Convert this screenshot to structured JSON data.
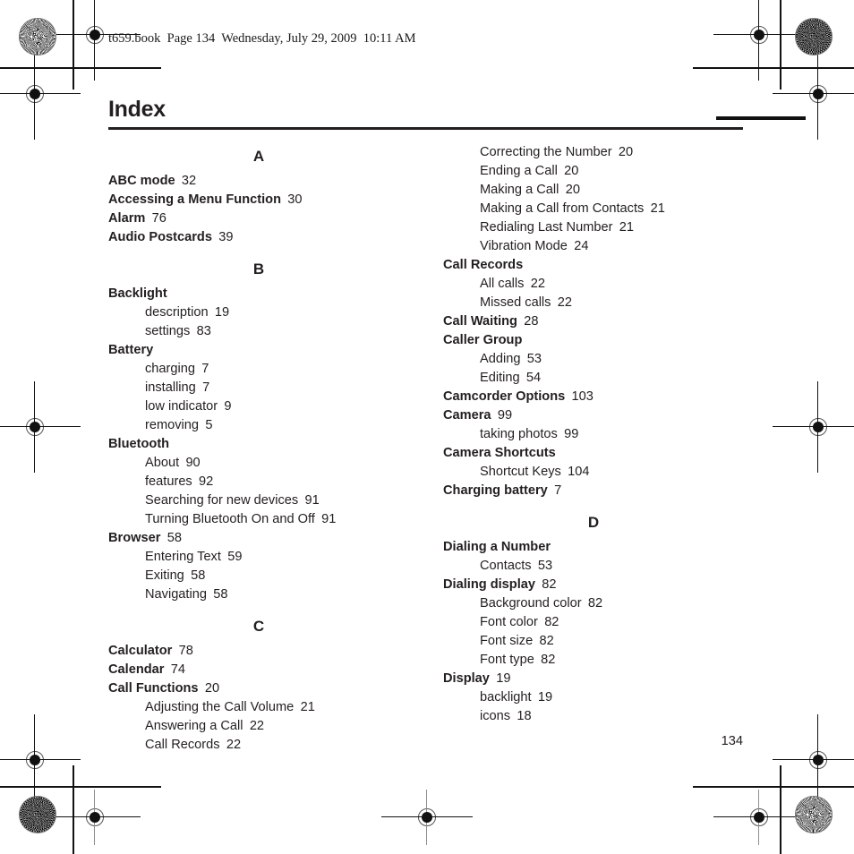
{
  "header": {
    "file_line": "t659.book  Page 134  Wednesday, July 29, 2009  10:11 AM"
  },
  "title": "Index",
  "folio": "134",
  "columns": [
    {
      "name": "left-column",
      "blocks": [
        {
          "type": "letter",
          "label": "A"
        },
        {
          "type": "entry",
          "label": "ABC mode",
          "page": "32"
        },
        {
          "type": "entry",
          "label": "Accessing a Menu Function",
          "page": "30"
        },
        {
          "type": "entry",
          "label": "Alarm",
          "page": "76"
        },
        {
          "type": "entry",
          "label": "Audio Postcards",
          "page": "39"
        },
        {
          "type": "letter",
          "label": "B"
        },
        {
          "type": "entry",
          "label": "Backlight",
          "page": ""
        },
        {
          "type": "sub",
          "label": "description",
          "page": "19"
        },
        {
          "type": "sub",
          "label": "settings",
          "page": "83"
        },
        {
          "type": "entry",
          "label": "Battery",
          "page": ""
        },
        {
          "type": "sub",
          "label": "charging",
          "page": "7"
        },
        {
          "type": "sub",
          "label": "installing",
          "page": "7"
        },
        {
          "type": "sub",
          "label": "low indicator",
          "page": "9"
        },
        {
          "type": "sub",
          "label": "removing",
          "page": "5"
        },
        {
          "type": "entry",
          "label": "Bluetooth",
          "page": ""
        },
        {
          "type": "sub",
          "label": "About",
          "page": "90"
        },
        {
          "type": "sub",
          "label": "features",
          "page": "92"
        },
        {
          "type": "sub",
          "label": "Searching for new devices",
          "page": "91"
        },
        {
          "type": "sub",
          "label": "Turning Bluetooth On and Off",
          "page": "91"
        },
        {
          "type": "entry",
          "label": "Browser",
          "page": "58"
        },
        {
          "type": "sub",
          "label": "Entering Text",
          "page": "59"
        },
        {
          "type": "sub",
          "label": "Exiting",
          "page": "58"
        },
        {
          "type": "sub",
          "label": "Navigating",
          "page": "58"
        },
        {
          "type": "letter",
          "label": "C"
        },
        {
          "type": "entry",
          "label": "Calculator",
          "page": "78"
        },
        {
          "type": "entry",
          "label": "Calendar",
          "page": "74"
        },
        {
          "type": "entry",
          "label": "Call Functions",
          "page": "20"
        },
        {
          "type": "sub",
          "label": "Adjusting the Call Volume",
          "page": "21"
        },
        {
          "type": "sub",
          "label": "Answering a Call",
          "page": "22"
        },
        {
          "type": "sub",
          "label": "Call Records",
          "page": "22"
        }
      ]
    },
    {
      "name": "right-column",
      "blocks": [
        {
          "type": "sub",
          "label": "Correcting the Number",
          "page": "20"
        },
        {
          "type": "sub",
          "label": "Ending a Call",
          "page": "20"
        },
        {
          "type": "sub",
          "label": "Making a Call",
          "page": "20"
        },
        {
          "type": "sub",
          "label": "Making a Call from Contacts",
          "page": "21"
        },
        {
          "type": "sub",
          "label": "Redialing Last Number",
          "page": "21"
        },
        {
          "type": "sub",
          "label": "Vibration Mode",
          "page": "24"
        },
        {
          "type": "entry",
          "label": "Call Records",
          "page": ""
        },
        {
          "type": "sub",
          "label": "All calls",
          "page": "22"
        },
        {
          "type": "sub",
          "label": "Missed calls",
          "page": "22"
        },
        {
          "type": "entry",
          "label": "Call Waiting",
          "page": "28"
        },
        {
          "type": "entry",
          "label": "Caller Group",
          "page": ""
        },
        {
          "type": "sub",
          "label": "Adding",
          "page": "53"
        },
        {
          "type": "sub",
          "label": "Editing",
          "page": "54"
        },
        {
          "type": "entry",
          "label": "Camcorder Options",
          "page": "103"
        },
        {
          "type": "entry",
          "label": "Camera",
          "page": "99"
        },
        {
          "type": "sub",
          "label": "taking photos",
          "page": "99"
        },
        {
          "type": "entry",
          "label": "Camera Shortcuts",
          "page": ""
        },
        {
          "type": "sub",
          "label": "Shortcut Keys",
          "page": "104"
        },
        {
          "type": "entry",
          "label": "Charging battery",
          "page": "7"
        },
        {
          "type": "letter",
          "label": "D"
        },
        {
          "type": "entry",
          "label": "Dialing a Number",
          "page": ""
        },
        {
          "type": "sub",
          "label": "Contacts",
          "page": "53"
        },
        {
          "type": "entry",
          "label": "Dialing display",
          "page": "82"
        },
        {
          "type": "sub",
          "label": "Background color",
          "page": "82"
        },
        {
          "type": "sub",
          "label": "Font color",
          "page": "82"
        },
        {
          "type": "sub",
          "label": "Font size",
          "page": "82"
        },
        {
          "type": "sub",
          "label": "Font type",
          "page": "82"
        },
        {
          "type": "entry",
          "label": "Display",
          "page": "19"
        },
        {
          "type": "sub",
          "label": "backlight",
          "page": "19"
        },
        {
          "type": "sub",
          "label": "icons",
          "page": "18"
        }
      ]
    }
  ]
}
